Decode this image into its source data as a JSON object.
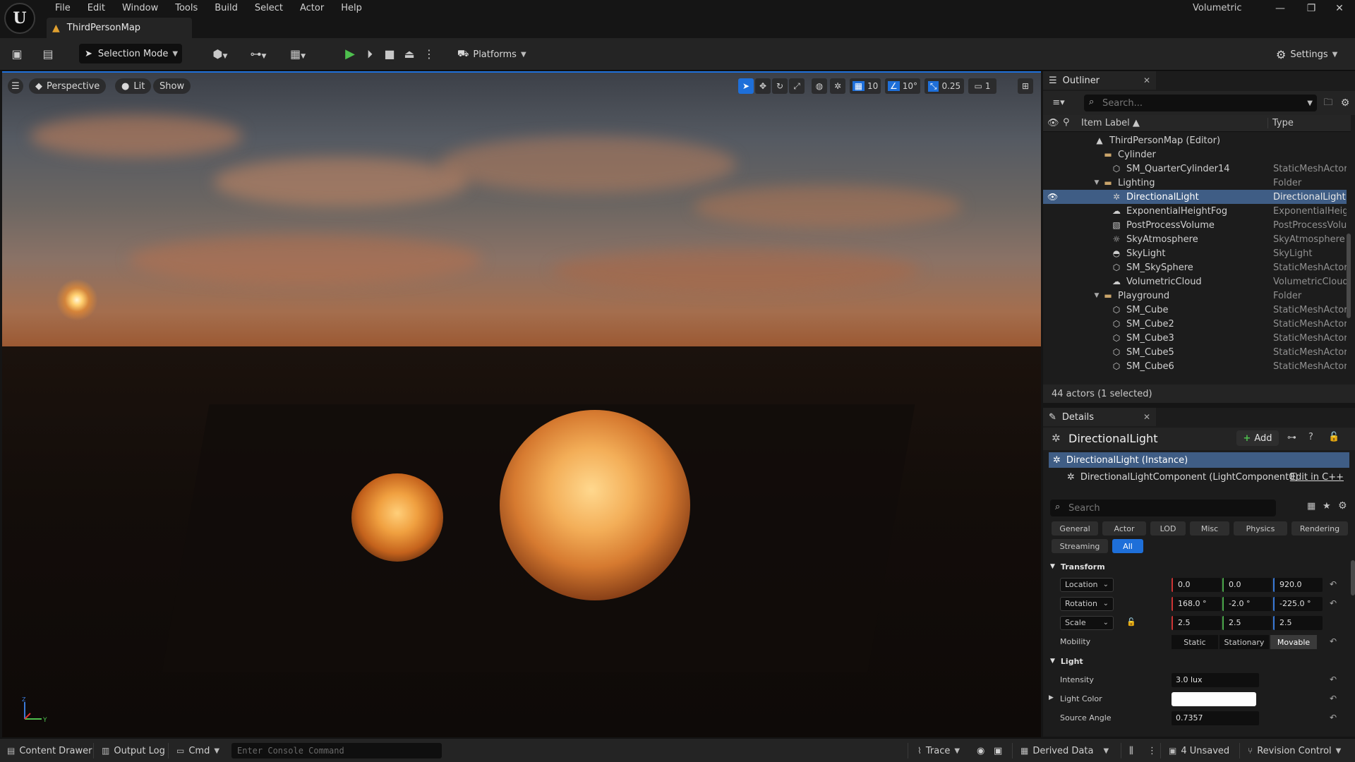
{
  "app": {
    "project_name": "Volumetric",
    "document_tab": "ThirdPersonMap",
    "menu": [
      "File",
      "Edit",
      "Window",
      "Tools",
      "Build",
      "Select",
      "Actor",
      "Help"
    ]
  },
  "toolbar": {
    "selection_mode": "Selection Mode",
    "platforms": "Platforms",
    "settings": "Settings"
  },
  "viewport": {
    "perspective": "Perspective",
    "lit": "Lit",
    "show": "Show",
    "grid_snap": "10",
    "rotation_snap": "10°",
    "scale_snap": "0.25",
    "camera_speed": "1"
  },
  "outliner": {
    "tab_title": "Outliner",
    "search_placeholder": "Search...",
    "col_label": "Item Label ▲",
    "col_type": "Type",
    "rows": [
      {
        "label": "ThirdPersonMap (Editor)",
        "type": "",
        "icon": "map-icon"
      },
      {
        "label": "Cylinder",
        "type": "",
        "icon": "folder-icon"
      },
      {
        "label": "SM_QuarterCylinder14",
        "type": "StaticMeshActor",
        "icon": "mesh-icon"
      },
      {
        "label": "Lighting",
        "type": "Folder",
        "icon": "folder-icon"
      },
      {
        "label": "DirectionalLight",
        "type": "DirectionalLight",
        "icon": "sun-icon"
      },
      {
        "label": "ExponentialHeightFog",
        "type": "ExponentialHeigh",
        "icon": "fog-icon"
      },
      {
        "label": "PostProcessVolume",
        "type": "PostProcessVolu",
        "icon": "volume-icon"
      },
      {
        "label": "SkyAtmosphere",
        "type": "SkyAtmosphere",
        "icon": "atmosphere-icon"
      },
      {
        "label": "SkyLight",
        "type": "SkyLight",
        "icon": "skylight-icon"
      },
      {
        "label": "SM_SkySphere",
        "type": "StaticMeshActor",
        "icon": "mesh-icon"
      },
      {
        "label": "VolumetricCloud",
        "type": "VolumetricCloud",
        "icon": "cloud-icon"
      },
      {
        "label": "Playground",
        "type": "Folder",
        "icon": "folder-icon"
      },
      {
        "label": "SM_Cube",
        "type": "StaticMeshActor",
        "icon": "mesh-icon"
      },
      {
        "label": "SM_Cube2",
        "type": "StaticMeshActor",
        "icon": "mesh-icon"
      },
      {
        "label": "SM_Cube3",
        "type": "StaticMeshActor",
        "icon": "mesh-icon"
      },
      {
        "label": "SM_Cube5",
        "type": "StaticMeshActor",
        "icon": "mesh-icon"
      },
      {
        "label": "SM_Cube6",
        "type": "StaticMeshActor",
        "icon": "mesh-icon"
      }
    ],
    "footer": "44 actors (1 selected)"
  },
  "details": {
    "tab_title": "Details",
    "actor_name": "DirectionalLight",
    "add_label": "Add",
    "instance_label": "DirectionalLight (Instance)",
    "component_label": "DirectionalLightComponent (LightComponent0)",
    "edit_cpp": "Edit in C++",
    "search_placeholder": "Search",
    "categories": [
      "General",
      "Actor",
      "LOD",
      "Misc",
      "Physics",
      "Rendering",
      "Streaming",
      "All"
    ],
    "active_category": "All",
    "transform": {
      "section": "Transform",
      "location_label": "Location",
      "location": [
        "0.0",
        "0.0",
        "920.0"
      ],
      "rotation_label": "Rotation",
      "rotation": [
        "168.0 °",
        "-2.0 °",
        "-225.0 °"
      ],
      "scale_label": "Scale",
      "scale": [
        "2.5",
        "2.5",
        "2.5"
      ],
      "mobility_label": "Mobility",
      "mobility_options": [
        "Static",
        "Stationary",
        "Movable"
      ],
      "mobility_selected": "Movable"
    },
    "light": {
      "section": "Light",
      "intensity_label": "Intensity",
      "intensity": "3.0 lux",
      "color_label": "Light Color",
      "color": "#ffffff",
      "source_angle_label": "Source Angle",
      "source_angle": "0.7357"
    }
  },
  "statusbar": {
    "content_drawer": "Content Drawer",
    "output_log": "Output Log",
    "cmd": "Cmd",
    "console_placeholder": "Enter Console Command",
    "trace": "Trace",
    "derived_data": "Derived Data",
    "unsaved": "4 Unsaved",
    "revision_control": "Revision Control"
  },
  "colors": {
    "accent": "#1e6fd9",
    "selection": "#3f5d85",
    "play_green": "#4ec04e"
  }
}
